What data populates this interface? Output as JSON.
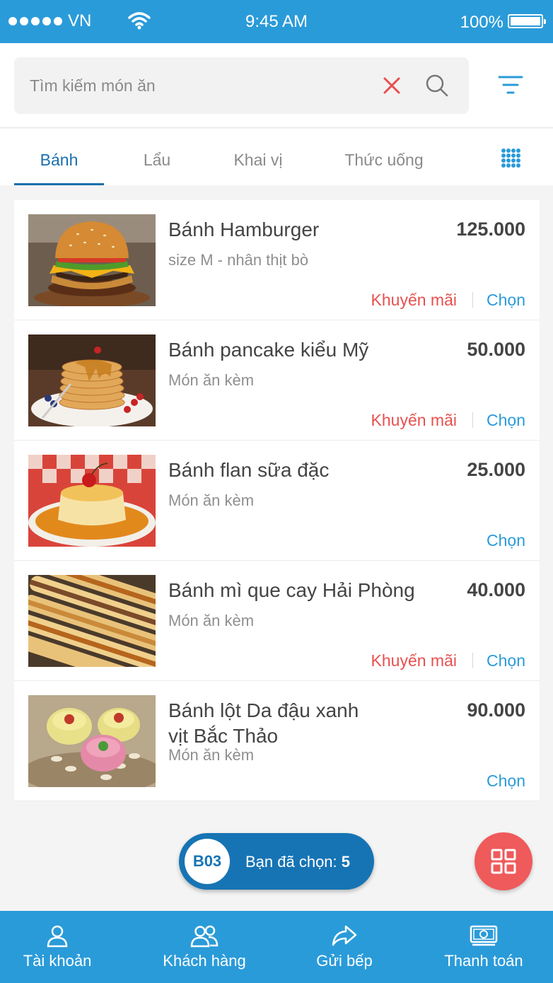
{
  "status_bar": {
    "carrier": "VN",
    "time": "9:45 AM",
    "battery": "100%"
  },
  "search": {
    "placeholder": "Tìm kiếm món ăn",
    "value": ""
  },
  "tabs": [
    {
      "label": "Bánh",
      "active": true
    },
    {
      "label": "Lẩu"
    },
    {
      "label": "Khai vị"
    },
    {
      "label": "Thức uống"
    }
  ],
  "items": [
    {
      "name": "Bánh Hamburger",
      "desc": "size M - nhân thịt bò",
      "price": "125.000",
      "promo": "Khuyến mãi",
      "choose": "Chọn"
    },
    {
      "name": "Bánh pancake kiểu Mỹ",
      "desc": "Món ăn kèm",
      "price": "50.000",
      "promo": "Khuyến mãi",
      "choose": "Chọn"
    },
    {
      "name": "Bánh flan sữa đặc",
      "desc": "Món ăn kèm",
      "price": "25.000",
      "choose": "Chọn"
    },
    {
      "name": "Bánh mì que cay Hải Phòng",
      "desc": "Món ăn kèm",
      "price": "40.000",
      "promo": "Khuyến mãi",
      "choose": "Chọn"
    },
    {
      "name": "Bánh lột Da đậu xanh vịt Bắc Thảo",
      "desc": "Món ăn kèm",
      "price": "90.000",
      "choose": "Chọn"
    }
  ],
  "selection": {
    "table": "B03",
    "label": "Bạn đã chọn:",
    "count": "5"
  },
  "bottom_nav": [
    {
      "label": "Tài khoản",
      "icon": "user-icon"
    },
    {
      "label": "Khách hàng",
      "icon": "users-icon"
    },
    {
      "label": "Gửi bếp",
      "icon": "share-icon"
    },
    {
      "label": "Thanh toán",
      "icon": "money-icon"
    }
  ],
  "colors": {
    "primary": "#2a9bd9",
    "dark_primary": "#1774b4",
    "accent_red": "#ef5a5b",
    "promo_red": "#e8504f"
  }
}
